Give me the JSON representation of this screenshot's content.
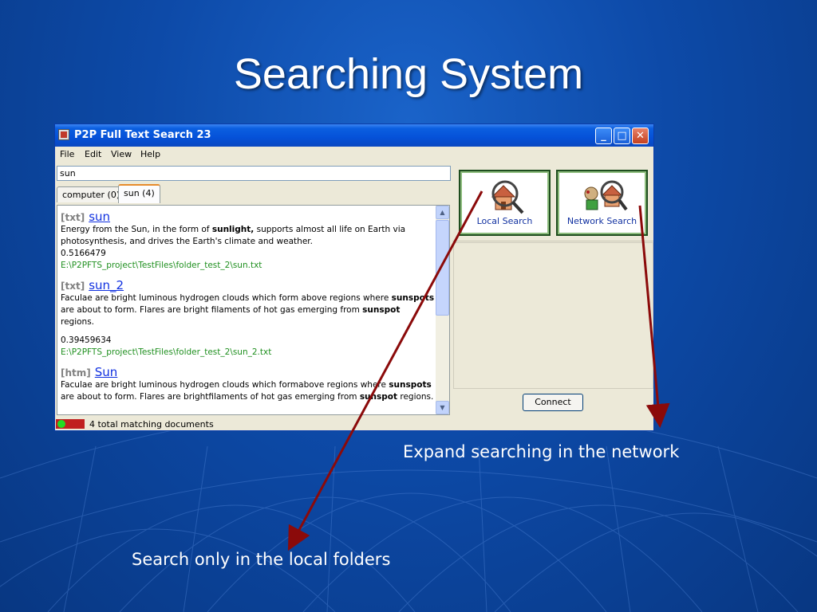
{
  "slide": {
    "title": "Searching System",
    "annotation_network": "Expand searching in the network",
    "annotation_local": "Search only in the local folders",
    "arrow_color": "#8b0a0a"
  },
  "window": {
    "title": "P2P Full Text Search 23",
    "controls": {
      "minimize": "_",
      "maximize": "□",
      "close": "✕"
    },
    "menu": [
      "File",
      "Edit",
      "View",
      "Help"
    ],
    "search_value": "sun",
    "tabs": [
      {
        "label": "computer (0)",
        "active": false
      },
      {
        "label": "sun (4)",
        "active": true
      }
    ],
    "results": [
      {
        "type": "[txt]",
        "title": "sun",
        "snippet_parts": [
          {
            "t": "Energy from the Sun, in the form of "
          },
          {
            "t": "sunlight,",
            "b": true
          },
          {
            "t": " supports almost all life on Earth via photosynthesis, and drives the Earth's climate and weather."
          }
        ],
        "score": "0.5166479",
        "path": "E:\\P2PFTS_project\\TestFiles\\folder_test_2\\sun.txt"
      },
      {
        "type": "[txt]",
        "title": "sun_2",
        "snippet_parts": [
          {
            "t": "Faculae are bright luminous hydrogen clouds which form above regions where "
          },
          {
            "t": "sunspots",
            "b": true
          },
          {
            "t": " are about to form. Flares are bright filaments of hot gas emerging from "
          },
          {
            "t": "sunspot",
            "b": true
          },
          {
            "t": " regions."
          }
        ],
        "score": "0.39459634",
        "path": "E:\\P2PFTS_project\\TestFiles\\folder_test_2\\sun_2.txt"
      },
      {
        "type": "[htm]",
        "title": "Sun",
        "snippet_parts": [
          {
            "t": "Faculae are bright luminous hydrogen clouds which formabove regions where "
          },
          {
            "t": "sunspots",
            "b": true
          },
          {
            "t": " are about to form. Flares are brightfilaments of hot gas emerging from "
          },
          {
            "t": "sunspot",
            "b": true
          },
          {
            "t": " regions."
          }
        ],
        "score": "",
        "path": ""
      }
    ],
    "local_search_label": "Local Search",
    "network_search_label": "Network Search",
    "connect_label": "Connect",
    "status_text": "4 total matching documents",
    "colors": {
      "titlebar": "#0551d8",
      "link": "#1030e0",
      "path": "#209020",
      "status_red": "#c02020",
      "status_green": "#22dd22"
    }
  }
}
